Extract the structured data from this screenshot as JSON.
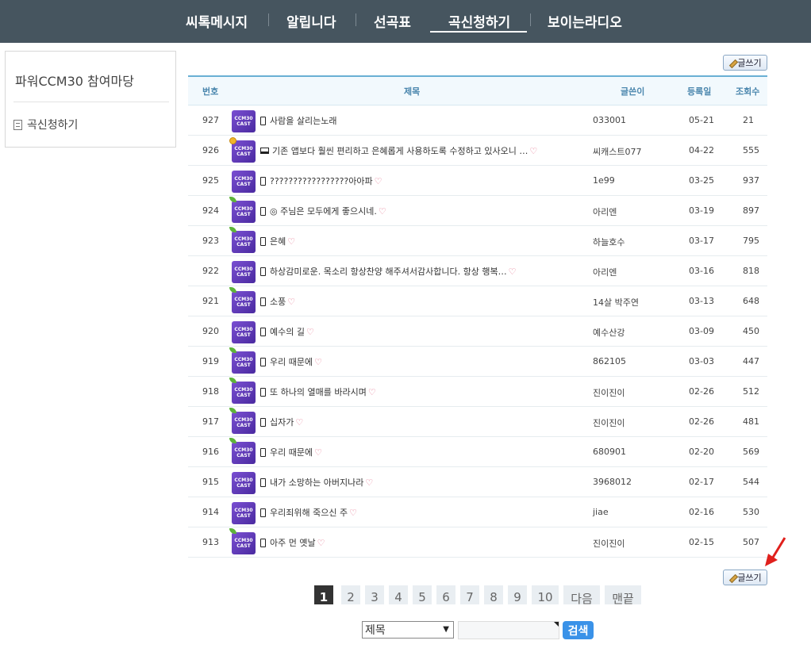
{
  "nav": {
    "items": [
      {
        "label": "씨톡메시지"
      },
      {
        "label": "알립니다"
      },
      {
        "label": "선곡표"
      },
      {
        "label": "곡신청하기",
        "active": true
      },
      {
        "label": "보이는라디오"
      }
    ]
  },
  "sidebar": {
    "title": "파워CCM30 참여마당",
    "items": [
      {
        "label": "곡신청하기",
        "icon": "document-icon"
      }
    ]
  },
  "write_button": {
    "label": "글쓰기",
    "icon": "pencil-icon"
  },
  "table": {
    "headers": {
      "no": "번호",
      "title": "제목",
      "author": "글쓴이",
      "date": "등록일",
      "views": "조회수"
    },
    "thumbnail_text": "CCM30\nCAST",
    "rows": [
      {
        "no": "927",
        "title": "사람을 살리는노래",
        "device": "mobile",
        "badge": "none",
        "heart": false,
        "author": "033001",
        "date": "05-21",
        "views": "21"
      },
      {
        "no": "926",
        "title": "기존 앱보다 훨씬 편리하고 은혜롭게 사용하도록 수정하고 있사오니 …",
        "device": "pc",
        "badge": "medal",
        "heart": true,
        "author": "씨캐스트077",
        "date": "04-22",
        "views": "555"
      },
      {
        "no": "925",
        "title": "?????????????????아아파",
        "device": "mobile",
        "badge": "none",
        "heart": true,
        "author": "1e99",
        "date": "03-25",
        "views": "937"
      },
      {
        "no": "924",
        "title": "◎ 주님은 모두에게 좋으시네.",
        "device": "mobile",
        "badge": "leaf",
        "heart": true,
        "author": "아리엔",
        "date": "03-19",
        "views": "897"
      },
      {
        "no": "923",
        "title": "은혜",
        "device": "mobile",
        "badge": "leaf",
        "heart": true,
        "author": "하늘호수",
        "date": "03-17",
        "views": "795"
      },
      {
        "no": "922",
        "title": "하상감미로운. 목소리 항상찬양 해주셔서감사합니다. 항상 행복…",
        "device": "mobile",
        "badge": "none",
        "heart": true,
        "author": "아리엔",
        "date": "03-16",
        "views": "818"
      },
      {
        "no": "921",
        "title": "소풍",
        "device": "mobile",
        "badge": "leaf",
        "heart": true,
        "author": "14살 박주연",
        "date": "03-13",
        "views": "648"
      },
      {
        "no": "920",
        "title": "예수의 길",
        "device": "mobile",
        "badge": "none",
        "heart": true,
        "author": "예수산강",
        "date": "03-09",
        "views": "450"
      },
      {
        "no": "919",
        "title": "우리 때문에",
        "device": "mobile",
        "badge": "leaf",
        "heart": true,
        "author": "862105",
        "date": "03-03",
        "views": "447"
      },
      {
        "no": "918",
        "title": "또 하나의 열매를 바라시며",
        "device": "mobile",
        "badge": "leaf",
        "heart": true,
        "author": "진이진이",
        "date": "02-26",
        "views": "512"
      },
      {
        "no": "917",
        "title": "십자가",
        "device": "mobile",
        "badge": "leaf",
        "heart": true,
        "author": "진이진이",
        "date": "02-26",
        "views": "481"
      },
      {
        "no": "916",
        "title": "우리 때문에",
        "device": "mobile",
        "badge": "leaf",
        "heart": true,
        "author": "680901",
        "date": "02-20",
        "views": "569"
      },
      {
        "no": "915",
        "title": "내가 소망하는 아버지나라",
        "device": "mobile",
        "badge": "none",
        "heart": true,
        "author": "3968012",
        "date": "02-17",
        "views": "544"
      },
      {
        "no": "914",
        "title": "우리죄위해 죽으신 주",
        "device": "mobile",
        "badge": "none",
        "heart": true,
        "author": "jiae",
        "date": "02-16",
        "views": "530"
      },
      {
        "no": "913",
        "title": "아주 먼 옛날",
        "device": "mobile",
        "badge": "leaf",
        "heart": true,
        "author": "진이진이",
        "date": "02-15",
        "views": "507"
      }
    ]
  },
  "pagination": {
    "items": [
      {
        "label": "1",
        "active": true
      },
      {
        "label": "2"
      },
      {
        "label": "3"
      },
      {
        "label": "4"
      },
      {
        "label": "5"
      },
      {
        "label": "6"
      },
      {
        "label": "7"
      },
      {
        "label": "8"
      },
      {
        "label": "9"
      },
      {
        "label": "10"
      },
      {
        "label": "다음"
      },
      {
        "label": "맨끝"
      }
    ]
  },
  "search": {
    "field_select": "제목",
    "query": "",
    "button_label": "검색"
  },
  "colors": {
    "nav_bg": "#46555f",
    "table_header_border": "#69b0d4",
    "search_button": "#3a92e8",
    "annotation_arrow": "#e0201c"
  }
}
